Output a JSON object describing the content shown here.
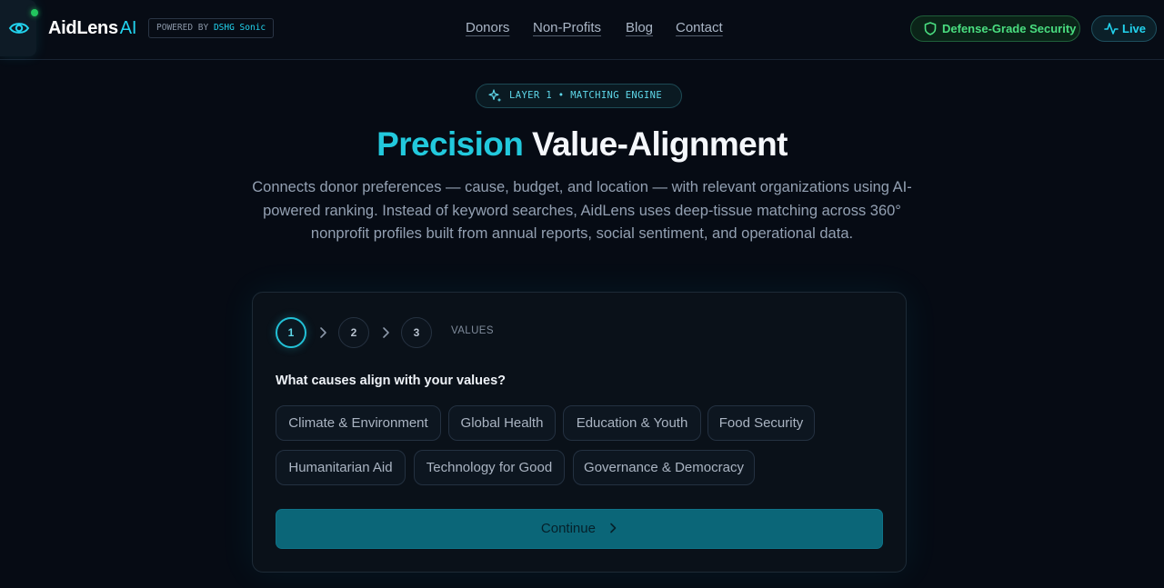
{
  "header": {
    "brand_name": "AidLens",
    "brand_suffix": "AI",
    "powered_prefix": "POWERED BY",
    "powered_name": "DSHG Sonic",
    "nav": [
      "Donors",
      "Non-Profits",
      "Blog",
      "Contact"
    ],
    "security_badge": "Defense-Grade Security",
    "live_badge": "Live",
    "icons": [
      "eye-icon",
      "shield-icon",
      "activity-icon"
    ],
    "colors": {
      "accent": "#22d3ee",
      "status_green": "#22c55e"
    }
  },
  "hero": {
    "badge": "LAYER 1 • MATCHING ENGINE",
    "badge_icon": "sparkles-icon",
    "title_accent": "Precision",
    "title_rest": "Value-Alignment",
    "description": "Connects donor preferences — cause, budget, and location — with relevant organizations using AI-powered ranking. Instead of keyword searches, AidLens uses deep-tissue matching across 360° nonprofit profiles built from annual reports, social sentiment, and operational data."
  },
  "wizard": {
    "steps": [
      "1",
      "2",
      "3"
    ],
    "active_step": 1,
    "step_label": "VALUES",
    "question": "What causes align with your values?",
    "causes": [
      "Climate & Environment",
      "Global Health",
      "Education & Youth",
      "Food Security",
      "Humanitarian Aid",
      "Technology for Good",
      "Governance & Democracy"
    ],
    "continue_label": "Continue"
  }
}
